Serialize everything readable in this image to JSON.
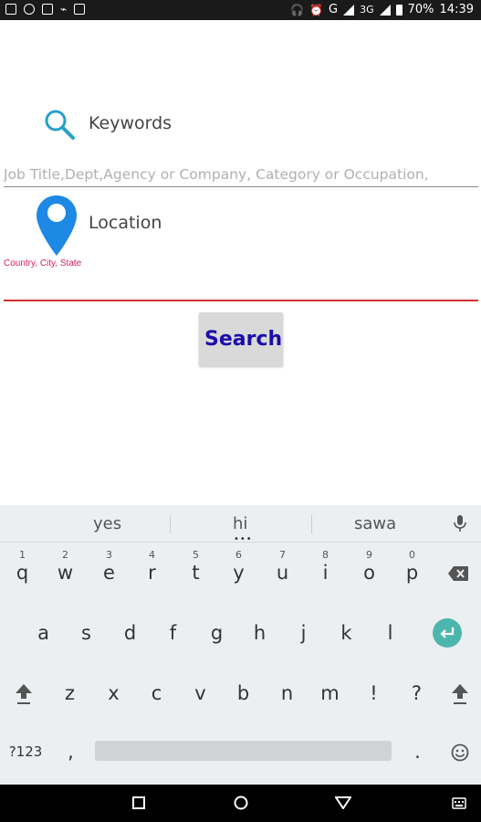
{
  "status_bar": {
    "battery": "70%",
    "time": "14:39",
    "network": "G",
    "network2": "3G"
  },
  "form": {
    "keywords_label": "Keywords",
    "keywords_placeholder": "Job Title,Dept,Agency or Company, Category or Occupation,",
    "location_label": "Location",
    "location_hint": "Country, City, State",
    "search_button": "Search"
  },
  "keyboard": {
    "suggestions": [
      "yes",
      "hi",
      "sawa"
    ],
    "row1": [
      {
        "key": "q",
        "hint": "1"
      },
      {
        "key": "w",
        "hint": "2"
      },
      {
        "key": "e",
        "hint": "3"
      },
      {
        "key": "r",
        "hint": "4"
      },
      {
        "key": "t",
        "hint": "5"
      },
      {
        "key": "y",
        "hint": "6"
      },
      {
        "key": "u",
        "hint": "7"
      },
      {
        "key": "i",
        "hint": "8"
      },
      {
        "key": "o",
        "hint": "9"
      },
      {
        "key": "p",
        "hint": "0"
      }
    ],
    "row2": [
      "a",
      "s",
      "d",
      "f",
      "g",
      "h",
      "j",
      "k",
      "l"
    ],
    "row3": [
      "z",
      "x",
      "c",
      "v",
      "b",
      "n",
      "m",
      "!",
      "?"
    ],
    "symbols_key": "?123",
    "comma_key": ",",
    "period_key": "."
  },
  "colors": {
    "status_bar": "#1a1a1a",
    "accent_teal": "#4db6ac",
    "location_pin": "#1e88e5",
    "location_underline": "#d32f2f",
    "search_text": "#1a0dab"
  }
}
